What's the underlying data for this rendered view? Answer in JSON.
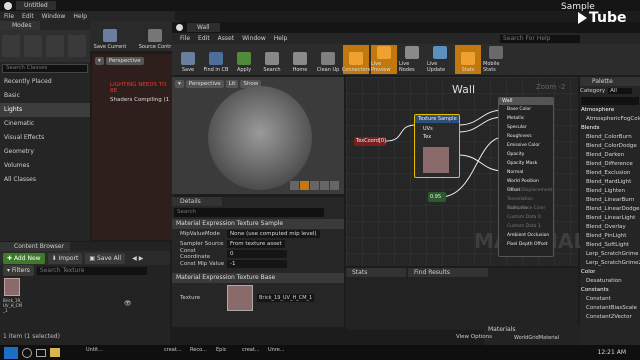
{
  "level_editor": {
    "tab": "Untitled",
    "menu": [
      "File",
      "Edit",
      "Window",
      "Help"
    ],
    "toolbar": {
      "save": "Save Current",
      "source": "Source Contr"
    },
    "modes": {
      "title": "Modes",
      "search_placeholder": "Search Classes",
      "classes": [
        "Recently Placed",
        "Basic",
        "Lights",
        "Cinematic",
        "Visual Effects",
        "Geometry",
        "Volumes",
        "All Classes"
      ],
      "selected": "Lights"
    },
    "viewport": {
      "perspective": "Perspective",
      "warning1": "LIGHTING NEEDS TO BE",
      "warning2": "Shaders Compiling (1"
    }
  },
  "content_browser": {
    "tab": "Content Browser",
    "add_new": "Add New",
    "import": "Import",
    "save_all": "Save All",
    "filters": "Filters",
    "search_placeholder": "Search Texture",
    "asset_label": "Brick_19_UV_H_CM_1",
    "status": "1 item (1 selected)"
  },
  "material_editor": {
    "tab": "Wall",
    "menu": [
      "File",
      "Edit",
      "Asset",
      "Window",
      "Help"
    ],
    "search_placeholder": "Search For Help",
    "toolbar": [
      {
        "label": "Save",
        "active": false,
        "color": "#6a7fa0"
      },
      {
        "label": "Find in CB",
        "active": false,
        "color": "#4d6f9b"
      },
      {
        "label": "Apply",
        "active": false,
        "color": "#4f8b3a"
      },
      {
        "label": "Search",
        "active": false,
        "color": "#888888"
      },
      {
        "label": "Home",
        "active": false,
        "color": "#8a8a8a"
      },
      {
        "label": "Clean Up",
        "active": false,
        "color": "#7f7f7f"
      },
      {
        "label": "Connectors",
        "active": true,
        "color": "#f0a030"
      },
      {
        "label": "Live Preview",
        "active": true,
        "color": "#f0a030"
      },
      {
        "label": "Live Nodes",
        "active": false,
        "color": "#8a8a8a"
      },
      {
        "label": "Live Update",
        "active": false,
        "color": "#5a8fc0"
      },
      {
        "label": "Stats",
        "active": true,
        "color": "#f0a030"
      },
      {
        "label": "Mobile Stats",
        "active": false,
        "color": "#6a6a6a"
      }
    ],
    "viewport": {
      "perspective": "Perspective",
      "lit": "Lit",
      "show": "Show"
    },
    "details": {
      "tab": "Details",
      "search_placeholder": "Search",
      "section1": "Material Expression Texture Sample",
      "rows": [
        {
          "key": "MipValueMode",
          "value": "None (use computed mip level)"
        },
        {
          "key": "Sampler Source",
          "value": "From texture asset"
        },
        {
          "key": "Const Coordinate",
          "value": "0"
        },
        {
          "key": "Const Mip Value",
          "value": "-1"
        }
      ],
      "section2": "Material Expression Texture Base",
      "texture_key": "Texture",
      "texture_value": "Brick_19_UV_H_CM_1"
    },
    "graph": {
      "title": "Wall",
      "zoom": "Zoom -2",
      "watermark": "MATERIAL",
      "texcoord": "TexCoord[0]",
      "texture_sample": "Texture Sample",
      "texture_pins": [
        "UVs",
        "Tex"
      ],
      "const_value": "0.95",
      "result_node": "Wall",
      "result_pins": [
        "Base Color",
        "Metallic",
        "Specular",
        "Roughness",
        "Emissive Color",
        "Opacity",
        "Opacity Mask",
        "Normal",
        "World Position Offset",
        "World Displacement",
        "Tessellation Multiplier",
        "Subsurface Color",
        "Custom Data 0",
        "Custom Data 1",
        "Ambient Occlusion",
        "Pixel Depth Offset"
      ]
    },
    "stats_tab": "Stats",
    "find_results_tab": "Find Results",
    "palette": {
      "tab": "Palette",
      "category_label": "Category",
      "category_value": "All",
      "items": [
        {
          "cat": "Atmosphere"
        },
        {
          "item": "AtmosphericFogColor"
        },
        {
          "cat": "Blends"
        },
        {
          "item": "Blend_ColorBurn"
        },
        {
          "item": "Blend_ColorDodge"
        },
        {
          "item": "Blend_Darken"
        },
        {
          "item": "Blend_Difference"
        },
        {
          "item": "Blend_Exclusion"
        },
        {
          "item": "Blend_HardLight"
        },
        {
          "item": "Blend_Lighten"
        },
        {
          "item": "Blend_LinearBurn"
        },
        {
          "item": "Blend_LinearDodge"
        },
        {
          "item": "Blend_LinearLight"
        },
        {
          "item": "Blend_Overlay"
        },
        {
          "item": "Blend_PinLight"
        },
        {
          "item": "Blend_SoftLight"
        },
        {
          "item": "Lerp_ScratchGrime"
        },
        {
          "item": "Lerp_ScratchGrime2"
        },
        {
          "cat": "Color"
        },
        {
          "item": "Desaturation"
        },
        {
          "cat": "Constants"
        },
        {
          "item": "Constant"
        },
        {
          "item": "ConstantBiasScale"
        },
        {
          "item": "Constant2Vector"
        }
      ]
    },
    "materials_tab": "Materials",
    "world_grid": "WorldGridMaterial",
    "view_options": "View Options"
  },
  "overlay": {
    "sample": "Sample",
    "tube": "Tube"
  },
  "taskbar": {
    "tasks": [
      "Untit...",
      "",
      "",
      "creat...",
      "Reco...",
      "Epic",
      "creat...",
      "Unre...",
      ""
    ],
    "time": "12:21 AM"
  }
}
